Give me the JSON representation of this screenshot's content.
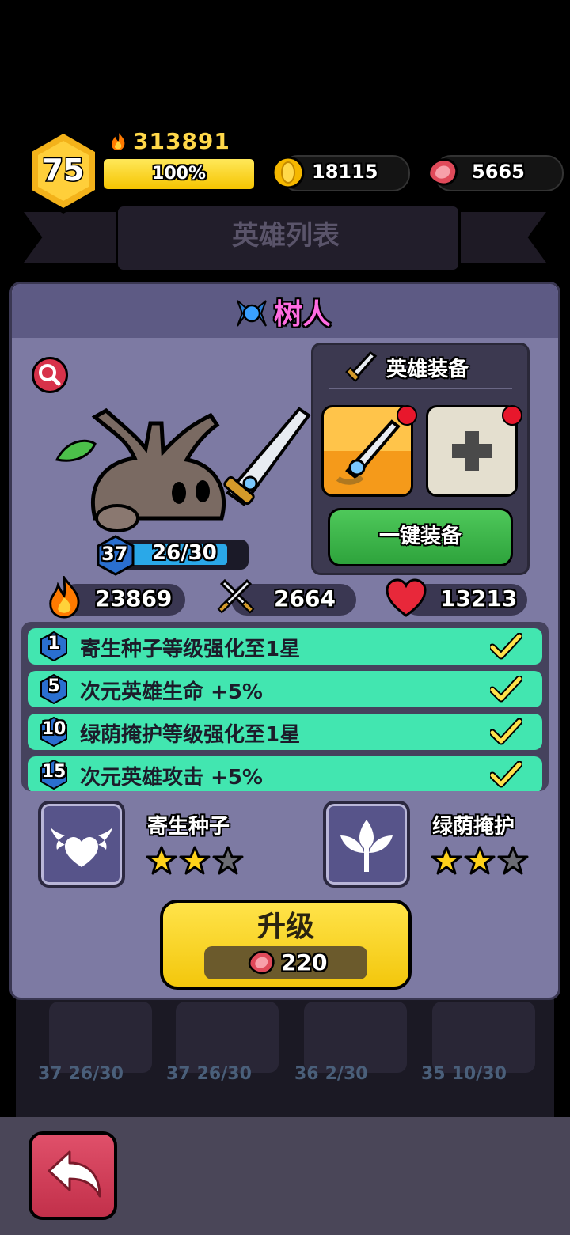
{
  "header": {
    "level": "75",
    "power": "313891",
    "xp_percent_label": "100%",
    "xp_fraction": 1.0,
    "gold": "18115",
    "meat": "5665"
  },
  "background": {
    "list_title": "英雄列表",
    "cards": [
      {
        "level": "37",
        "progress": "26/30"
      },
      {
        "level": "37",
        "progress": "26/30"
      },
      {
        "level": "36",
        "progress": "2/30"
      },
      {
        "level": "35",
        "progress": "10/30"
      }
    ]
  },
  "hero": {
    "name": "树人",
    "level": "37",
    "shards": "26/30",
    "shard_fraction": 0.8667,
    "power": "23869",
    "attack": "2664",
    "health": "13213"
  },
  "equipment": {
    "title": "英雄装备",
    "one_click_label": "一键装备"
  },
  "bonuses": [
    {
      "level": "1",
      "text": "寄生种子等级强化至1星"
    },
    {
      "level": "5",
      "text": "次元英雄生命  +5%"
    },
    {
      "level": "10",
      "text": "绿荫掩护等级强化至1星"
    },
    {
      "level": "15",
      "text": "次元英雄攻击  +5%"
    }
  ],
  "skills": [
    {
      "name": "寄生种子",
      "stars": 2,
      "max_stars": 3,
      "icon": "winged-heart-icon"
    },
    {
      "name": "绿荫掩护",
      "stars": 2,
      "max_stars": 3,
      "icon": "sprout-icon"
    }
  ],
  "upgrade": {
    "label": "升级",
    "cost": "220"
  },
  "colors": {
    "panel": "#7d7aa3",
    "bonus_row": "#42e6b0",
    "name": "#ff6ce2",
    "upgrade": "#f3c70c"
  }
}
